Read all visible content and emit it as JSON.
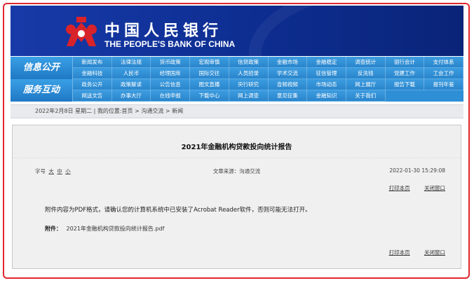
{
  "header": {
    "title_cn": "中国人民银行",
    "title_en": "THE PEOPLE'S BANK OF CHINA"
  },
  "nav": {
    "section1": "信息公开",
    "section2": "服务互动",
    "items": [
      "新闻发布",
      "法律法规",
      "货币政策",
      "宏观审慎",
      "信贷政策",
      "金融市场",
      "金融稳定",
      "调查统计",
      "银行会计",
      "支付体系",
      "金融科技",
      "人民币",
      "经理国库",
      "国际交往",
      "人员招录",
      "学术交流",
      "征信管理",
      "反洗钱",
      "党建工作",
      "工会工作",
      "政务公开",
      "政策解读",
      "公告信息",
      "图文直播",
      "央行研究",
      "音频视频",
      "市场动态",
      "网上展厅",
      "报告下载",
      "报刊年鉴",
      "网送文告",
      "办事大厅",
      "在线申报",
      "下载中心",
      "网上调查",
      "意见征集",
      "金融知识",
      "关于我们"
    ]
  },
  "breadcrumb": "2022年2月8日 星期二 | 我的位置:首页 > 沟通交流 > 新闻",
  "article": {
    "title": "2021年金融机构贷款投向统计报告",
    "font_label": "字号",
    "font_sizes": [
      "大",
      "中",
      "小"
    ],
    "source": "文章来源：沟通交流",
    "date": "2022-01-30 15:29:08",
    "print_label": "打印本页",
    "close_label": "关闭窗口",
    "notice": "附件内容为PDF格式，请确认您的计算机系统中已安装了Acrobat Reader软件，否则可能无法打开。",
    "attachment_label": "附件：",
    "attachment_file": "2021年金融机构贷款投向统计报告.pdf"
  },
  "colors": {
    "banner": "#0d2d90",
    "nav": "#2f8fd6",
    "frame": "#e0262e",
    "logo": "#d8232a"
  }
}
